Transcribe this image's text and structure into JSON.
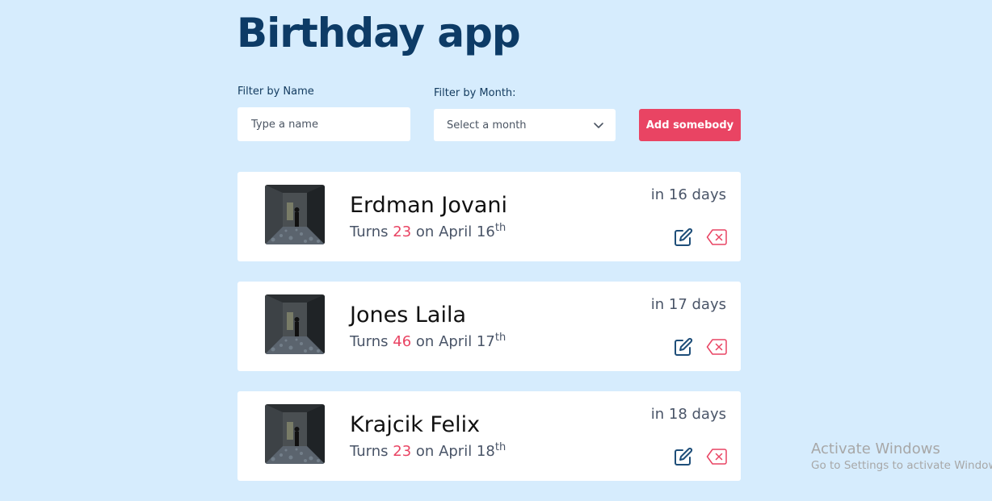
{
  "app": {
    "title": "Birthday app"
  },
  "filters": {
    "name_label": "Filter by Name",
    "name_placeholder": "Type a name",
    "month_label": "Filter by Month:",
    "month_placeholder": "Select a month",
    "add_button": "Add somebody"
  },
  "people": [
    {
      "name": "Erdman Jovani",
      "turns_prefix": "Turns",
      "age": "23",
      "date_text": "on April 16",
      "ordinal": "th",
      "days_until": "in 16 days"
    },
    {
      "name": "Jones Laila",
      "turns_prefix": "Turns",
      "age": "46",
      "date_text": "on April 17",
      "ordinal": "th",
      "days_until": "in 17 days"
    },
    {
      "name": "Krajcik Felix",
      "turns_prefix": "Turns",
      "age": "23",
      "date_text": "on April 18",
      "ordinal": "th",
      "days_until": "in 18 days"
    }
  ],
  "watermark": {
    "line1": "Activate Windows",
    "line2": "Go to Settings to activate Windows."
  },
  "colors": {
    "background": "#d6ecfd",
    "title": "#0d3b66",
    "accent": "#e94463",
    "card": "#ffffff",
    "muted_text": "#4a5568"
  },
  "icons": {
    "month_select": "chevron-down-icon",
    "edit": "edit-icon",
    "delete": "backspace-icon"
  }
}
